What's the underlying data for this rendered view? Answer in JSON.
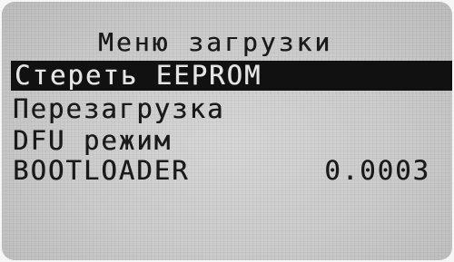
{
  "screen": {
    "title": "Меню загрузки"
  },
  "menu": {
    "items": [
      {
        "label": "Стереть EEPROM",
        "selected": true
      },
      {
        "label": "Перезагрузка",
        "selected": false
      },
      {
        "label": "DFU режим",
        "selected": false
      },
      {
        "label": "BOOTLOADER",
        "selected": false
      }
    ]
  },
  "bootloader": {
    "version": "0.0003"
  },
  "colors": {
    "lcd_background": "#cbcbcb",
    "text": "#1a1a1a",
    "highlight_bar": "#111111",
    "highlight_text": "#e4e4e4"
  }
}
